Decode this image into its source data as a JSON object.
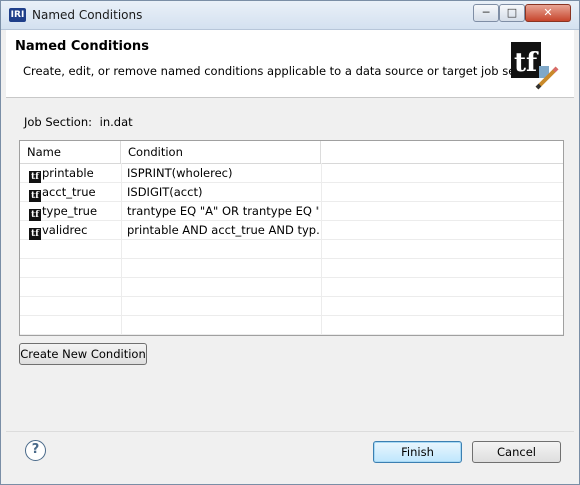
{
  "window": {
    "app_icon_text": "IRI",
    "title": "Named Conditions",
    "min_glyph": "─",
    "max_glyph": "□",
    "close_glyph": "✕"
  },
  "header": {
    "title": "Named Conditions",
    "description": "Create, edit, or remove named conditions applicable to a data source or target job section",
    "logo_text": "tf"
  },
  "job_section": {
    "label": "Job Section:",
    "value": "in.dat"
  },
  "table": {
    "columns": [
      "Name",
      "Condition"
    ],
    "icon_text": "tf",
    "rows": [
      {
        "name": "printable",
        "condition": "ISPRINT(wholerec)"
      },
      {
        "name": "acct_true",
        "condition": "ISDIGIT(acct)"
      },
      {
        "name": "type_true",
        "condition": "trantype EQ \"A\" OR trantype EQ \"..."
      },
      {
        "name": "validrec",
        "condition": "printable AND acct_true AND typ..."
      }
    ]
  },
  "buttons": {
    "create": "Create New Condition",
    "finish": "Finish",
    "cancel": "Cancel",
    "help": "?"
  },
  "colors": {
    "accent": "#3c7fb1",
    "titlebar": "#d4e1f0"
  }
}
